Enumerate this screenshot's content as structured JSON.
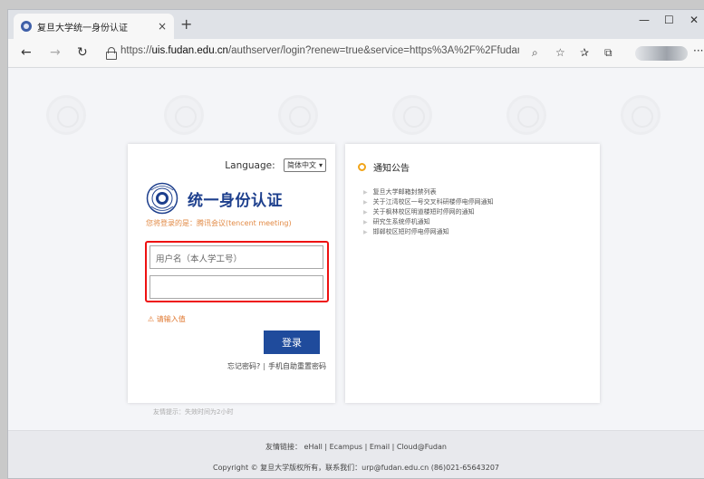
{
  "browser": {
    "tab_title": "复旦大学统一身份认证",
    "tab_close": "×",
    "new_tab": "+",
    "url_prefix": "https://",
    "url_host": "uis.fudan.edu.cn",
    "url_rest": "/authserver/login?renew=true&service=https%3A%2F%2Ffudan-idp.id.m...",
    "controls": {
      "minimize": "—",
      "maximize": "☐",
      "close": "✕"
    },
    "nav": {
      "back": "←",
      "forward": "→",
      "refresh": "↻"
    },
    "toolbar_icons": {
      "read_aloud": "⌕",
      "favorites_add": "☆",
      "favorites": "✰",
      "collections": "⧉",
      "more": "···"
    }
  },
  "login": {
    "language_label": "Language:",
    "language_value": "简体中文",
    "language_caret": "▾",
    "title": "统一身份认证",
    "hint": "您将登录的是：腾讯会议(tencent meeting)",
    "username_placeholder": "用户名（本人学工号）",
    "password_value": "",
    "error_icon": "⚠",
    "error": "请输入值",
    "submit": "登录",
    "forgot": "忘记密码?",
    "separator": "|",
    "reset_mobile": "手机自助重置密码"
  },
  "tip": "友情提示：失效时间为2小时",
  "notice": {
    "title": "通知公告",
    "items": [
      "复旦大学邮箱封禁列表",
      "关于江湾校区一号交叉科研楼停电停网通知",
      "关于枫林校区明道楼短时停网的通知",
      "研究生系统停机通知",
      "邯郸校区短时停电停网通知"
    ],
    "arrow": "▶"
  },
  "footer": {
    "links": "友情链接：  eHall | Ecampus | Email | Cloud@Fudan",
    "copyright": "Copyright © 复旦大学版权所有，联系我们：urp@fudan.edu.cn (86)021-65643207"
  },
  "colors": {
    "brand_blue": "#1f4b9c",
    "hint_orange": "#e28a45",
    "highlight_red": "#e11",
    "notice_dot": "#f1a51a"
  }
}
